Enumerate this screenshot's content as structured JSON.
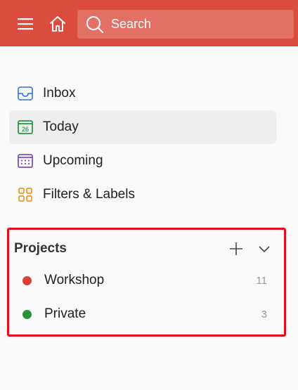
{
  "topbar": {
    "menu_icon": "hamburger-menu-icon",
    "home_icon": "home-icon",
    "search": {
      "placeholder": "Search",
      "icon": "search-icon"
    },
    "bg_color": "#db4c3f"
  },
  "nav": {
    "items": [
      {
        "label": "Inbox",
        "icon": "inbox-icon",
        "active": false
      },
      {
        "label": "Today",
        "icon": "calendar-today-icon",
        "day": "26",
        "active": true
      },
      {
        "label": "Upcoming",
        "icon": "calendar-upcoming-icon",
        "active": false
      },
      {
        "label": "Filters & Labels",
        "icon": "filters-grid-icon",
        "active": false
      }
    ]
  },
  "projects": {
    "title": "Projects",
    "add_icon": "plus-icon",
    "collapse_icon": "chevron-down-icon",
    "highlight_color": "#e8091a",
    "items": [
      {
        "name": "Workshop",
        "count": "11",
        "color": "#db4035"
      },
      {
        "name": "Private",
        "count": "3",
        "color": "#299438"
      }
    ]
  }
}
